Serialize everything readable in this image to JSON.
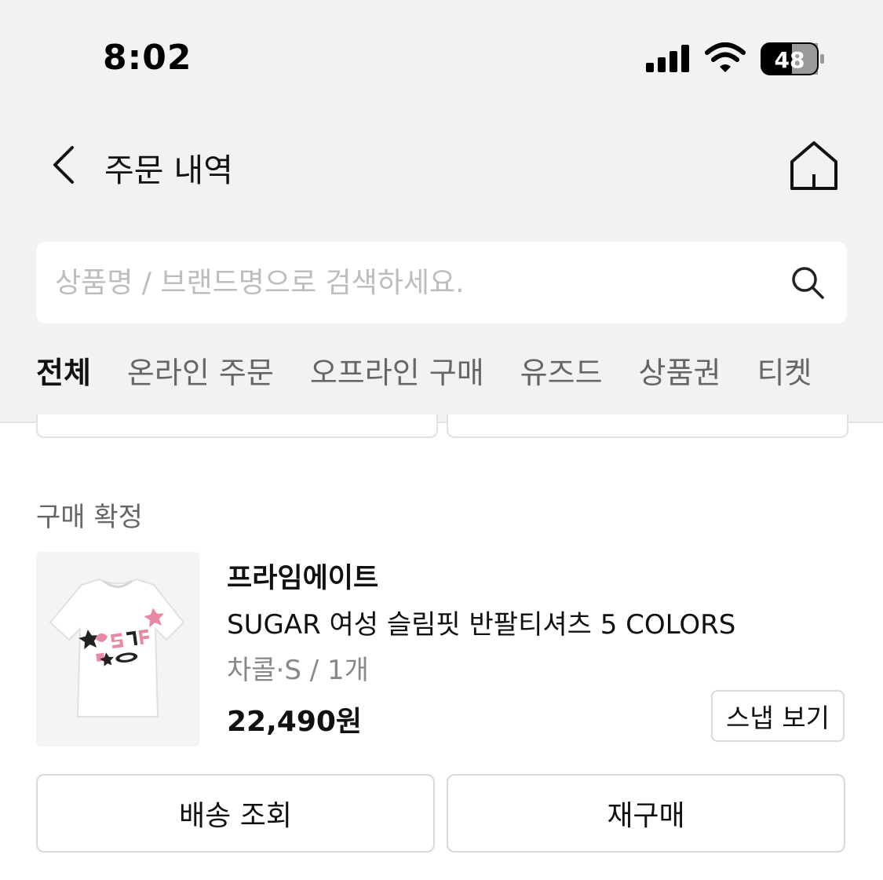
{
  "status_bar": {
    "time": "8:02",
    "battery_level": "48"
  },
  "header": {
    "title": "주문 내역",
    "back_icon": "chevron-left-icon",
    "home_icon": "home-icon"
  },
  "search": {
    "placeholder": "상품명 / 브랜드명으로 검색하세요.",
    "value": "",
    "icon": "search-icon"
  },
  "tabs": [
    {
      "label": "전체",
      "active": true
    },
    {
      "label": "온라인 주문",
      "active": false
    },
    {
      "label": "오프라인 구매",
      "active": false
    },
    {
      "label": "유즈드",
      "active": false
    },
    {
      "label": "상품권",
      "active": false
    },
    {
      "label": "티켓",
      "active": false
    }
  ],
  "order": {
    "status": "구매 확정",
    "brand": "프라임에이트",
    "product_name": "SUGAR 여성 슬림핏 반팔티셔츠 5 COLORS",
    "option": "차콜·S / 1개",
    "price": "22,490원",
    "snap_label": "스냅 보기",
    "track_label": "배송 조회",
    "rebuy_label": "재구매"
  },
  "colors": {
    "background_top": "#f2f2f2",
    "accent": "#111111",
    "muted_text": "#888888"
  }
}
